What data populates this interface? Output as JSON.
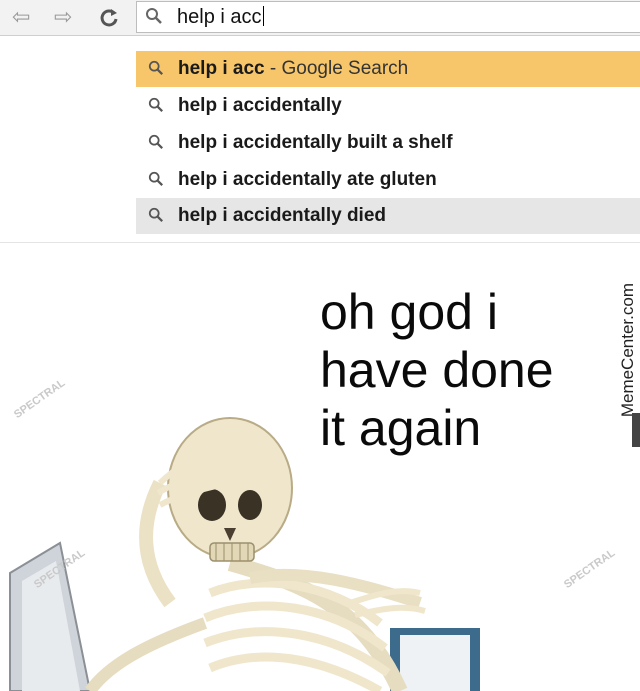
{
  "toolbar": {
    "back_icon": "back-arrow-icon",
    "forward_icon": "forward-arrow-icon",
    "reload_icon": "reload-icon",
    "omnibox_text": "help i acc"
  },
  "suggestions": [
    {
      "text": "help i acc",
      "suffix": " - Google Search",
      "state": "highlighted"
    },
    {
      "text": "help i accidentally",
      "suffix": "",
      "state": "normal"
    },
    {
      "text": "help i accidentally built a shelf",
      "suffix": "",
      "state": "normal"
    },
    {
      "text": "help i accidentally ate gluten",
      "suffix": "",
      "state": "normal"
    },
    {
      "text": "help i accidentally died",
      "suffix": "",
      "state": "hover"
    }
  ],
  "meme": {
    "caption_lines": [
      "oh god i",
      "have done",
      "it again"
    ],
    "watermark": "MemeCenter.com",
    "faint_marks": [
      "SPECTRAL",
      "SPECTRAL",
      "SPECTRAL"
    ]
  },
  "colors": {
    "highlight": "#f7c66a",
    "hover_row": "#e6e6e6",
    "toolbar_bg": "#f2f2f2"
  }
}
